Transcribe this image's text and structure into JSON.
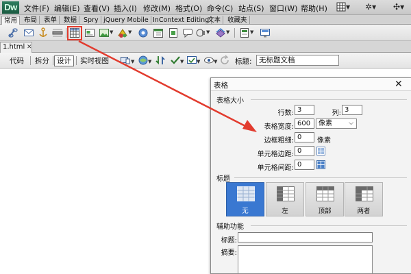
{
  "app": {
    "logo": "Dw",
    "menu": [
      "文件(F)",
      "编辑(E)",
      "查看(V)",
      "插入(I)",
      "修改(M)",
      "格式(O)",
      "命令(C)",
      "站点(S)",
      "窗口(W)",
      "帮助(H)"
    ]
  },
  "insert_panel": {
    "tabs": [
      "常用",
      "布局",
      "表单",
      "数据",
      "Spry",
      "jQuery Mobile",
      "InContext Editing",
      "文本",
      "收藏夹"
    ],
    "active_tab": "常用",
    "icons": [
      "hyperlink-icon",
      "email-link-icon",
      "named-anchor-icon",
      "horizontal-rule-icon",
      "table-icon",
      "insert-div-icon",
      "images-icon",
      "media-icon",
      "widget-icon",
      "date-icon",
      "server-include-icon",
      "comment-icon",
      "head-icon",
      "script-icon",
      "templates-icon",
      "tag-chooser-icon"
    ],
    "highlighted_icon": "table-icon"
  },
  "document": {
    "tab_label": "1.html",
    "views": [
      "代码",
      "拆分",
      "设计",
      "实时视图"
    ],
    "active_view": "设计",
    "title_label": "标题:",
    "title_value": "无标题文档"
  },
  "dialog": {
    "title": "表格",
    "section_size": "表格大小",
    "rows_label": "行数:",
    "rows_value": "3",
    "cols_label": "列:",
    "cols_value": "3",
    "width_label": "表格宽度:",
    "width_value": "600",
    "width_unit": "像素",
    "border_label": "边框粗细:",
    "border_value": "0",
    "border_unit": "像素",
    "padding_label": "单元格边距:",
    "padding_value": "0",
    "spacing_label": "单元格间距:",
    "spacing_value": "0",
    "section_header": "标题",
    "header_options": [
      "无",
      "左",
      "顶部",
      "两者"
    ],
    "header_selected": "无",
    "section_access": "辅助功能",
    "caption_label": "标题:",
    "caption_value": "",
    "summary_label": "摘要:",
    "summary_value": ""
  },
  "colors": {
    "accent_arrow": "#e23b2e",
    "selected_option": "#3a78d1",
    "logo_bg": "#2e7d5e"
  }
}
